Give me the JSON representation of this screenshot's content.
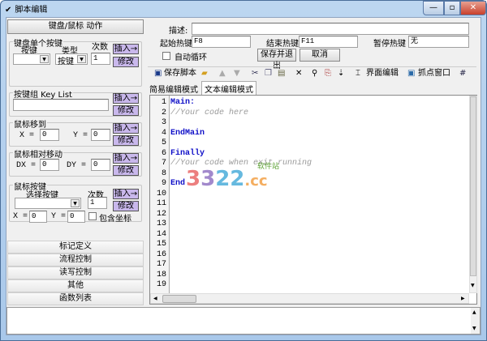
{
  "window": {
    "title": "脚本编辑",
    "minimize": "—",
    "maximize": "▫",
    "close": "✕"
  },
  "left": {
    "header": "键盘/鼠标 动作",
    "single_key": {
      "legend": "键盘单个按键",
      "key_label": "按键",
      "type_label": "类型",
      "count_label": "次数",
      "type_value": "按键",
      "count_value": "1",
      "insert": "插入→",
      "modify": "修改"
    },
    "key_list": {
      "legend": "按键组 Key List",
      "value": "",
      "insert": "插入→",
      "modify": "修改"
    },
    "mouse_move": {
      "legend": "鼠标移到",
      "x_label": "X =",
      "x_value": "0",
      "y_label": "Y =",
      "y_value": "0",
      "insert": "插入→",
      "modify": "修改"
    },
    "mouse_rel": {
      "legend": "鼠标相对移动",
      "dx_label": "DX =",
      "dx_value": "0",
      "dy_label": "DY =",
      "dy_value": "0",
      "insert": "插入→",
      "modify": "修改"
    },
    "mouse_btn": {
      "legend": "鼠标按键",
      "select_label": "选择按键",
      "count_label": "次数",
      "count_value": "1",
      "x_label": "X =",
      "x_value": "0",
      "y_label": "Y =",
      "y_value": "0",
      "include_coords": "包含坐标",
      "insert": "插入→",
      "modify": "修改"
    },
    "sections": [
      "标记定义",
      "流程控制",
      "读写控制",
      "其他",
      "函数列表"
    ]
  },
  "top": {
    "desc_label": "描述:",
    "desc_value": "",
    "start_label": "起始热键",
    "start_value": "F8",
    "end_label": "结束热键",
    "end_value": "F11",
    "pause_label": "暂停热键",
    "pause_value": "无",
    "auto_loop": "自动循环",
    "auto_loop_checked": false,
    "save_exit": "保存并退出",
    "cancel": "取消"
  },
  "toolbar": {
    "save_script": "保存脚本",
    "ui_edit": "界面编辑",
    "capture_window": "抓点窗口"
  },
  "tabs": [
    {
      "label": "简易编辑模式",
      "active": false
    },
    {
      "label": "文本编辑模式",
      "active": true
    }
  ],
  "editor": {
    "lines": [
      {
        "n": "1",
        "text": "Main:",
        "kind": "kw"
      },
      {
        "n": "2",
        "text": "//Your code here",
        "kind": "cm"
      },
      {
        "n": "3",
        "text": "",
        "kind": ""
      },
      {
        "n": "4",
        "text": "EndMain",
        "kind": "kw"
      },
      {
        "n": "5",
        "text": "",
        "kind": ""
      },
      {
        "n": "6",
        "text": "Finally",
        "kind": "kw"
      },
      {
        "n": "7",
        "text": "//Your code when exit running",
        "kind": "cm"
      },
      {
        "n": "8",
        "text": "",
        "kind": ""
      },
      {
        "n": "9",
        "text": "End",
        "kind": "kw"
      },
      {
        "n": "10",
        "text": "",
        "kind": ""
      },
      {
        "n": "11",
        "text": "",
        "kind": ""
      },
      {
        "n": "12",
        "text": "",
        "kind": ""
      },
      {
        "n": "13",
        "text": "",
        "kind": ""
      },
      {
        "n": "14",
        "text": "",
        "kind": ""
      },
      {
        "n": "15",
        "text": "",
        "kind": ""
      },
      {
        "n": "16",
        "text": "",
        "kind": ""
      },
      {
        "n": "17",
        "text": "",
        "kind": ""
      },
      {
        "n": "18",
        "text": "",
        "kind": ""
      },
      {
        "n": "19",
        "text": "",
        "kind": ""
      }
    ]
  },
  "watermark": {
    "text": "3322.cc",
    "sub": "软件站"
  },
  "colors": {
    "purple_button": "#c9b8ec",
    "keyword": "#1010c8",
    "comment": "#999999",
    "frame": "#a9c8ea"
  }
}
